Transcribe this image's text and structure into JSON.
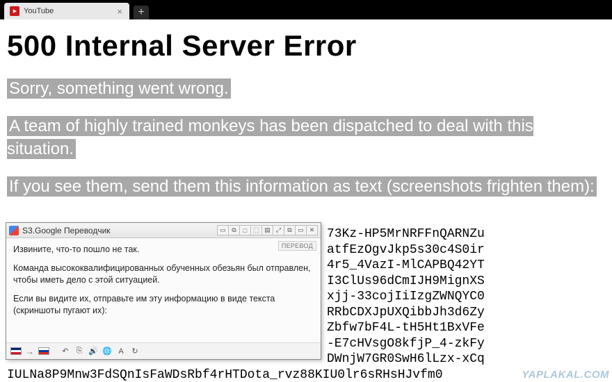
{
  "browser": {
    "tab_title": "YouTube",
    "new_tab_glyph": "+",
    "close_glyph": "×"
  },
  "error": {
    "heading": "500 Internal Server Error",
    "line1": "Sorry, something went wrong.",
    "line2": "A team of highly trained monkeys has been dispatched to deal with this situation.",
    "line3": "If you see them, send them this information as text (screenshots frighten them):"
  },
  "dump_lines": [
    "73Kz-HP5MrNRFFnQARNZu",
    "atfEzOgvJkp5s30c4S0ir",
    "4r5_4VazI-MlCAPBQ42YT",
    "I3ClUs96dCmIJH9MignXS",
    "xjj-33cojIiIzgZWNQYC0",
    "RRbCDXJpUXQibbJh3d6Zy",
    "Zbfw7bF4L-tH5Ht1BxVFe",
    "-E7cHVsgO8kfjP_4-zkFy",
    "DWnjW7GR0SwH6lLzx-xCq",
    "IULNa8P9Mnw3FdSQnIsFaWDsRbf4rHTDota_rvz88KIU0lr6sRHsHJvfm0"
  ],
  "translator": {
    "title": "S3.Google Переводчик",
    "translate_btn": "ПЕРЕВОД",
    "para1": "Извините, что-то пошло не так.",
    "para2": "Команда высококвалифицированных обученных обезьян был отправлен, чтобы иметь дело с этой ситуацией.",
    "para3": "Если вы видите их, отправьте им эту информацию в виде текста (скриншоты пугают их):",
    "toolbar_glyphs": [
      "▭",
      "⧉",
      "□",
      "⿴",
      "▤",
      "⤢",
      "⧉",
      "▭",
      "✕"
    ],
    "footer_icons": {
      "arrow": "→",
      "undo": "↶",
      "copy": "⎘",
      "sound": "🔊",
      "globe": "🌐",
      "a_letter": "A",
      "refresh": "↻"
    }
  },
  "watermark": "YAPLAKAL.COM"
}
